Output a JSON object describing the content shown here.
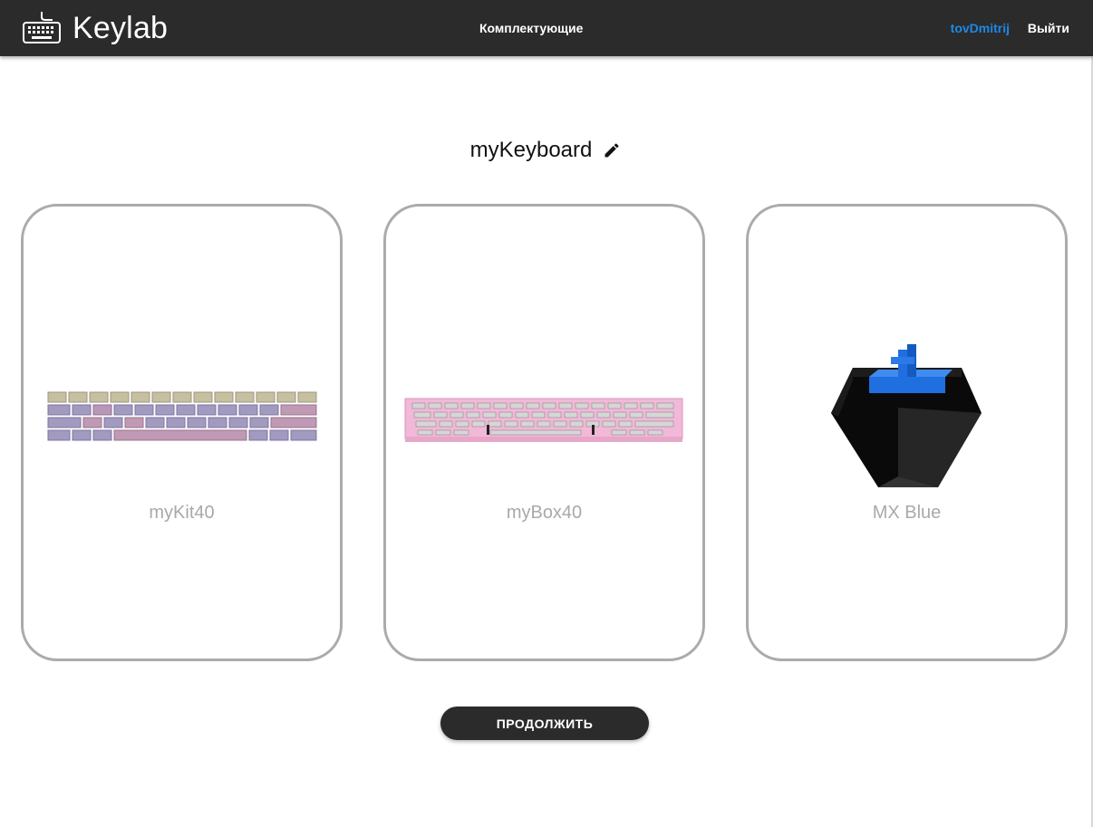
{
  "header": {
    "brand": "Keylab",
    "brand_icon": "keyboard-icon",
    "nav_link": "Комплектующие",
    "username": "tovDmitrij",
    "logout": "Выйти"
  },
  "build": {
    "name": "myKeyboard",
    "edit_icon": "pencil-icon"
  },
  "cards": [
    {
      "label": "myKit40",
      "image": "keycap-set-image"
    },
    {
      "label": "myBox40",
      "image": "keyboard-box-image"
    },
    {
      "label": "MX Blue",
      "image": "switch-image"
    }
  ],
  "continue_button": "ПРОДОЛЖИТЬ",
  "colors": {
    "header_bg": "#2b2b2b",
    "user_link": "#1e88e5",
    "card_border": "#ababab",
    "card_label": "#a9a9a9",
    "box_color": "#f2b8d8",
    "switch_stem": "#1f6fe0"
  }
}
